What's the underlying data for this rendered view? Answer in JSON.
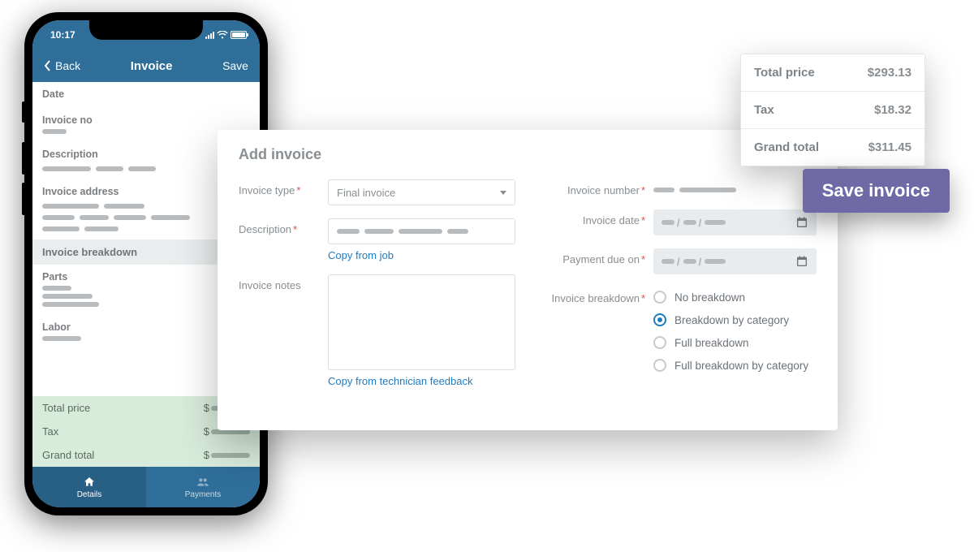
{
  "phone": {
    "status_time": "10:17",
    "back_label": "Back",
    "title": "Invoice",
    "save_label": "Save",
    "fields": {
      "date": "Date",
      "invoice_no": "Invoice no",
      "description": "Description",
      "invoice_address": "Invoice address"
    },
    "section_breakdown": "Invoice breakdown",
    "parts_label": "Parts",
    "labor_label": "Labor",
    "totals": {
      "total_price": "Total price",
      "tax": "Tax",
      "grand_total": "Grand total",
      "currency": "$"
    },
    "tabs": {
      "details": "Details",
      "payments": "Payments"
    }
  },
  "card": {
    "title": "Add invoice",
    "labels": {
      "invoice_type": "Invoice type",
      "description": "Description",
      "invoice_notes": "Invoice notes",
      "invoice_number": "Invoice number",
      "invoice_date": "Invoice date",
      "payment_due_on": "Payment due on",
      "invoice_breakdown": "Invoice breakdown"
    },
    "invoice_type_value": "Final invoice",
    "links": {
      "copy_from_job": "Copy from job",
      "copy_from_tech": "Copy from technician feedback"
    },
    "breakdown_options": [
      {
        "label": "No breakdown",
        "checked": false
      },
      {
        "label": "Breakdown by category",
        "checked": true
      },
      {
        "label": "Full breakdown",
        "checked": false
      },
      {
        "label": "Full breakdown by category",
        "checked": false
      }
    ]
  },
  "price": {
    "rows": [
      {
        "label": "Total price",
        "value": "$293.13"
      },
      {
        "label": "Tax",
        "value": "$18.32"
      },
      {
        "label": "Grand total",
        "value": "$311.45"
      }
    ]
  },
  "save_button": "Save invoice"
}
